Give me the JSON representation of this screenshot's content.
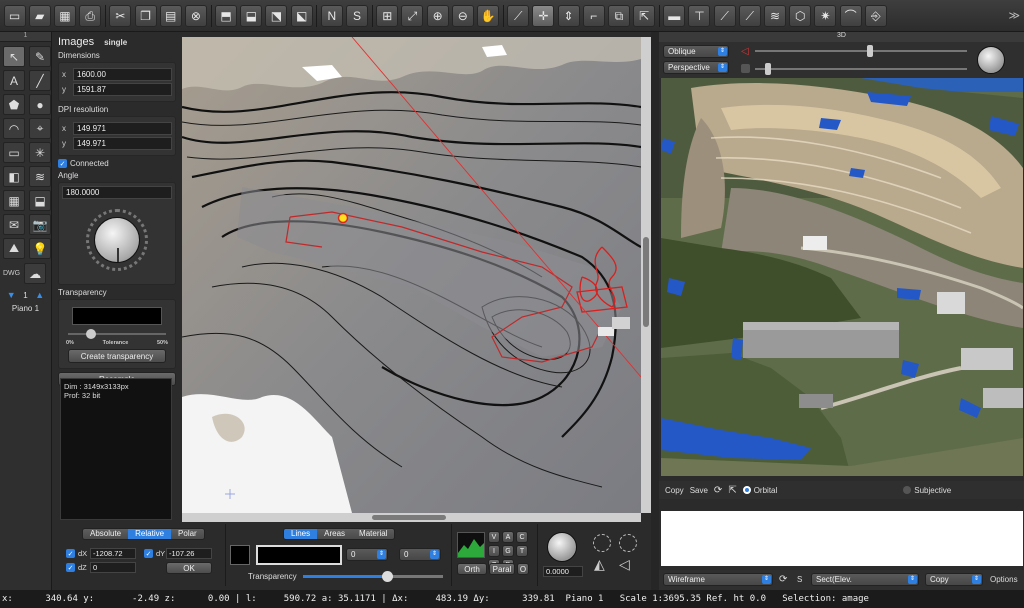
{
  "toolbar": {
    "icons": [
      "new-document",
      "open-folder",
      "save",
      "print",
      "cut",
      "copy",
      "paste",
      "delete",
      "move-back",
      "move-front",
      "send-back",
      "bring-front",
      "snap-n",
      "snap-s",
      "fit-window",
      "full-extent",
      "zoom-in",
      "zoom-out",
      "pan-hand",
      "line-tool",
      "crosshair",
      "vertical-measure",
      "stairs",
      "shape-crop",
      "pointer-select",
      "layer-bar",
      "section-cut",
      "slope",
      "ruler-tool",
      "stack",
      "cube",
      "wheel",
      "arch",
      "door"
    ],
    "glyphs": [
      "▭",
      "▰",
      "▦",
      "⎙",
      "✂",
      "❐",
      "▤",
      "⊗",
      "⬒",
      "⬓",
      "⬔",
      "⬕",
      "N",
      "S",
      "⊞",
      "⤢",
      "⊕",
      "⊖",
      "✋",
      "⟋",
      "✛",
      "⇕",
      "⌐",
      "⧉",
      "⇱",
      "▬",
      "⊤",
      "⟋",
      "⟋",
      "≋",
      "⬡",
      "✷",
      "⌒",
      "⎆"
    ],
    "more": "≫"
  },
  "toolcol": {
    "header": "1",
    "tools": [
      "pointer",
      "pencil",
      "text",
      "line",
      "polygon",
      "circle",
      "arc",
      "dimension",
      "rectangle",
      "snowflake",
      "wall",
      "stairs",
      "window",
      "brush",
      "image",
      "camera",
      "terrain",
      "light"
    ],
    "glyphs": [
      "↖",
      "✎",
      "A",
      "╱",
      "⬟",
      "●",
      "◠",
      "⌖",
      "▭",
      "✳",
      "◧",
      "≋",
      "▦",
      "⬓",
      "✉",
      "📷",
      "⛰",
      "💡"
    ],
    "dwg_label": "DWG",
    "floor_number": "1",
    "floor_name": "Piano 1"
  },
  "props": {
    "title": "Images",
    "mode": "single",
    "dimensions_label": "Dimensions",
    "dim_x": "1600.00",
    "dim_y": "1591.87",
    "dpi_label": "DPI resolution",
    "dpi_x": "149.971",
    "dpi_y": "149.971",
    "connected_label": "Connected",
    "angle_label": "Angle",
    "angle_value": "180.0000",
    "transparency_label": "Transparency",
    "tol_min": "0%",
    "tol_label": "Tolerance",
    "tol_max": "50%",
    "create_transparency": "Create transparency",
    "resample": "Resample",
    "info_dim": "Dim : 3149x3133px",
    "info_prof": "Prof: 32 bit"
  },
  "p3d": {
    "title": "3D",
    "view_mode": "Oblique",
    "projection": "Perspective",
    "copy": "Copy",
    "save": "Save",
    "orbital": "Orbital",
    "subjective": "Subjective",
    "render_mode": "Wireframe",
    "s_label": "S",
    "section": "Sect(Elev.",
    "copy_mode": "Copy",
    "options": "Options"
  },
  "bpanel": {
    "tabs": [
      "Absolute",
      "Relative",
      "Polar"
    ],
    "active_tab": "Relative",
    "dx_label": "dX",
    "dx": "-1208.72",
    "dy_label": "dY",
    "dy": "-107.26",
    "dz_label": "dZ",
    "dz": "0",
    "ok": "OK",
    "style_tabs": [
      "Lines",
      "Areas",
      "Material"
    ],
    "active_style": "Lines",
    "line_val1": "0",
    "line_val2": "0",
    "transparency_label": "Transparency",
    "transparency_value": 0.6,
    "grid_buttons": [
      "V",
      "A",
      "C",
      "I",
      "G",
      "T",
      "Z",
      "D"
    ],
    "orth": "Orth",
    "paral": "Paral",
    "o": "O",
    "rotation_value": "0.0000"
  },
  "status": "x:      340.64 y:       -2.49 z:      0.00 | l:     590.72 a: 35.1171 | Δx:     483.19 Δy:      339.81  Piano 1   Scale 1:3695.35 Ref. ht 0.0   Selection: amage"
}
